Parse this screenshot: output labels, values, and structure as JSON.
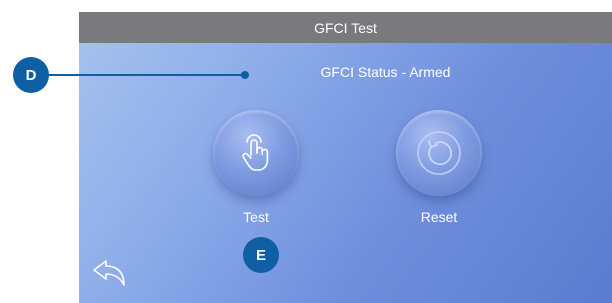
{
  "screen": {
    "title": "GFCI Test",
    "status_text": "GFCI Status - Armed"
  },
  "buttons": {
    "test": {
      "label": "Test",
      "icon": "hand-tap-icon"
    },
    "reset": {
      "label": "Reset",
      "icon": "reset-circle-icon"
    }
  },
  "navigation": {
    "back_icon": "back-arrow-icon"
  },
  "callouts": {
    "d": "D",
    "e": "E"
  },
  "colors": {
    "title_bar": "#7a7a7e",
    "callout": "#0f5fa5",
    "screen_gradient_start": "#a8c3ee",
    "screen_gradient_end": "#5b7ccf"
  }
}
